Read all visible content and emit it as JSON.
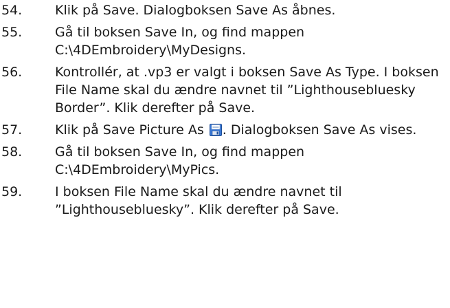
{
  "steps": [
    {
      "num": "54.",
      "text": "Klik på Save. Dialogboksen Save As åbnes."
    },
    {
      "num": "55.",
      "text": "Gå til boksen Save In, og find mappen C:\\4DEmbroidery\\MyDesigns."
    },
    {
      "num": "56.",
      "text": "Kontrollér, at .vp3 er valgt i boksen Save As Type. I boksen File Name skal du ændre navnet til ”Lighthousebluesky Border”. Klik derefter på Save."
    },
    {
      "num": "57.",
      "text_before": "Klik på Save Picture As ",
      "icon": "save-picture-icon",
      "text_after": ". Dialogboksen Save As vises."
    },
    {
      "num": "58.",
      "text": "Gå til boksen Save In, og find mappen C:\\4DEmbroidery\\MyPics."
    },
    {
      "num": "59.",
      "text": "I boksen File Name skal du ændre navnet til ”Lighthousebluesky”. Klik derefter på Save."
    }
  ]
}
